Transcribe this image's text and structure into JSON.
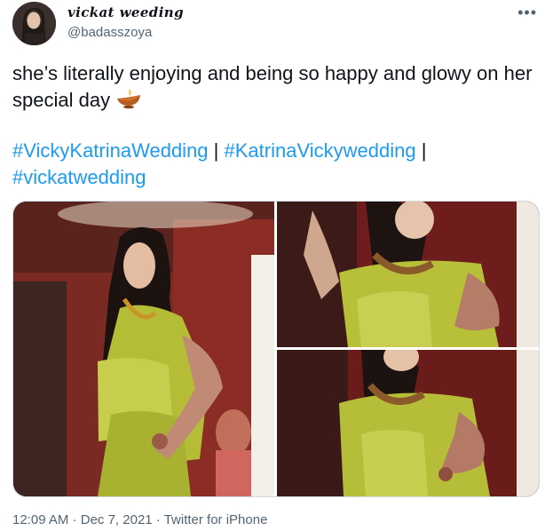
{
  "author": {
    "display_name": "vickat weeding",
    "handle": "@badasszoya"
  },
  "tweet": {
    "text": "she’s literally enjoying and being so happy and glowy on her special day",
    "emoji": "diya-lamp-icon",
    "hashtags": [
      "#VickyKatrinaWedding",
      "#KatrinaVickywedding",
      "#vickatwedding"
    ],
    "separator": "|"
  },
  "media": {
    "count": 3,
    "images": [
      {
        "name": "bride-dancing-photo"
      },
      {
        "name": "bride-dancing-closeup-photo"
      },
      {
        "name": "bride-dancing-closeup-photo-2"
      }
    ]
  },
  "footer": {
    "time": "12:09 AM",
    "dot": "·",
    "date": "Dec 7, 2021",
    "source": "Twitter for iPhone"
  },
  "colors": {
    "link": "#1d9bf0",
    "text": "#0f1419",
    "muted": "#536471",
    "saree_green": "#b7c03a",
    "background_red": "#6e1c1c"
  }
}
